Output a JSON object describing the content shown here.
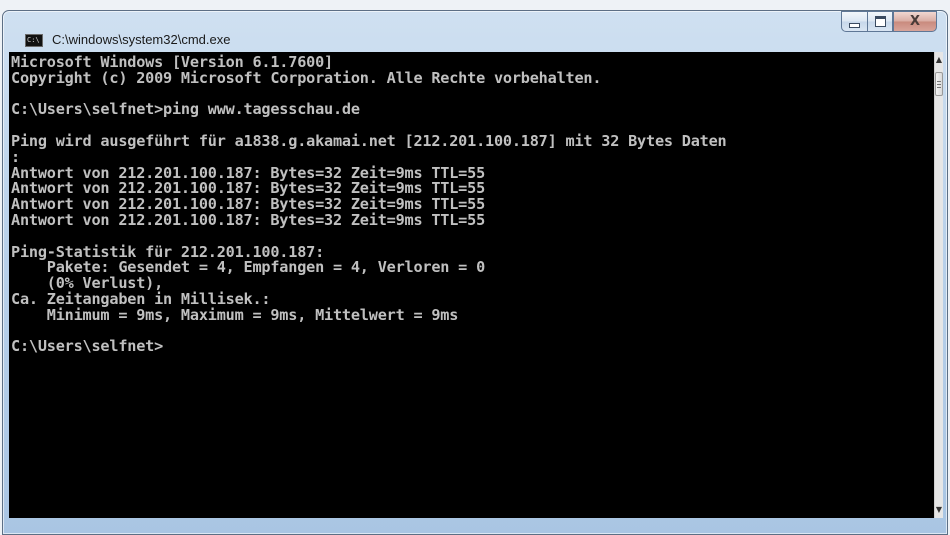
{
  "window": {
    "title": "C:\\windows\\system32\\cmd.exe",
    "icon": "cmd-icon",
    "icon_text": "C:\\"
  },
  "controls": {
    "minimize_icon": "minimize-icon",
    "maximize_icon": "maximize-icon",
    "close_icon": "close-icon",
    "close_glyph": "X"
  },
  "console": {
    "text_color": "#c0c0c0",
    "background": "#000000",
    "lines": [
      "Microsoft Windows [Version 6.1.7600]",
      "Copyright (c) 2009 Microsoft Corporation. Alle Rechte vorbehalten.",
      "",
      "C:\\Users\\selfnet>ping www.tagesschau.de",
      "",
      "Ping wird ausgeführt für a1838.g.akamai.net [212.201.100.187] mit 32 Bytes Daten",
      ":",
      "Antwort von 212.201.100.187: Bytes=32 Zeit=9ms TTL=55",
      "Antwort von 212.201.100.187: Bytes=32 Zeit=9ms TTL=55",
      "Antwort von 212.201.100.187: Bytes=32 Zeit=9ms TTL=55",
      "Antwort von 212.201.100.187: Bytes=32 Zeit=9ms TTL=55",
      "",
      "Ping-Statistik für 212.201.100.187:",
      "    Pakete: Gesendet = 4, Empfangen = 4, Verloren = 0",
      "    (0% Verlust),",
      "Ca. Zeitangaben in Millisek.:",
      "    Minimum = 9ms, Maximum = 9ms, Mittelwert = 9ms",
      "",
      "C:\\Users\\selfnet>"
    ]
  },
  "scrollbar": {
    "up_arrow": "▲",
    "down_arrow": "▼"
  }
}
